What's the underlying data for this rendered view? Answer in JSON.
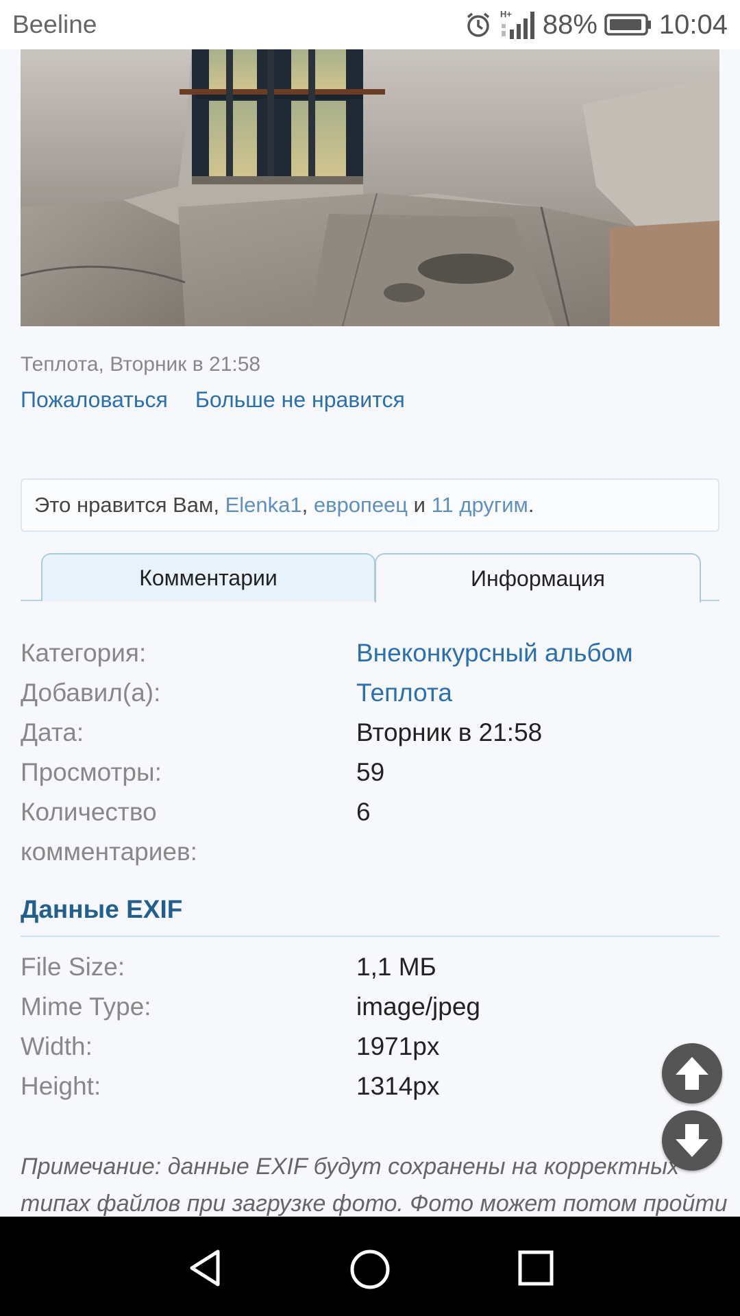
{
  "status_bar": {
    "carrier": "Beeline",
    "network_type": "H+",
    "battery": "88%",
    "time": "10:04",
    "icons": [
      "alarm-icon",
      "signal-icon",
      "battery-icon"
    ]
  },
  "photo": {
    "post_caption": "Теплота, Вторник в 21:58",
    "actions": {
      "report": "Пожаловаться",
      "unlike": "Больше не нравится"
    }
  },
  "likes": {
    "prefix": "Это нравится Вам, ",
    "user1": "Elenka1",
    "sep": ", ",
    "user2": "европеец",
    "and": " и ",
    "others": "11 другим",
    "suffix": "."
  },
  "tabs": {
    "comments": "Комментарии",
    "info": "Информация",
    "active": "info"
  },
  "info": {
    "category_label": "Категория:",
    "category_value": "Внеконкурсный альбом",
    "added_label": "Добавил(а):",
    "added_value": "Теплота",
    "date_label": "Дата:",
    "date_value": "Вторник в 21:58",
    "views_label": "Просмотры:",
    "views_value": "59",
    "comments_label_1": "Количество",
    "comments_label_2": "комментариев:",
    "comments_value": "6"
  },
  "exif": {
    "title": "Данные EXIF",
    "file_size_label": "File Size:",
    "file_size_value": "1,1 МБ",
    "mime_label": "Mime Type:",
    "mime_value": "image/jpeg",
    "width_label": "Width:",
    "width_value": "1971px",
    "height_label": "Height:",
    "height_value": "1314px"
  },
  "note": {
    "line1": "Примечание: данные EXIF будут сохранены на корректных",
    "line2": "типах файлов при загрузке фото. Фото может потом пройти"
  },
  "colors": {
    "link": "#2a6fae",
    "tab_inactive_bg": "#e7f2fb",
    "exif_title": "#215f8e",
    "page_bg": "#f7f8fc"
  }
}
